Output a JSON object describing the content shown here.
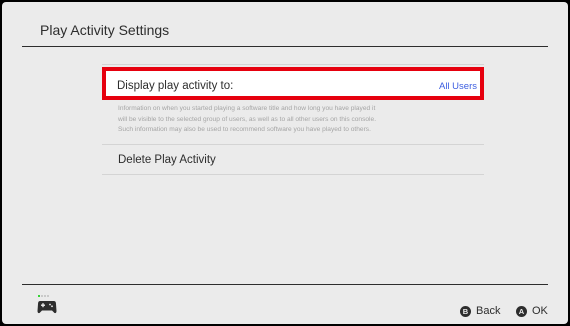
{
  "header": {
    "title": "Play Activity Settings"
  },
  "settings": {
    "display_play_activity": {
      "label": "Display play activity to:",
      "value": "All Users",
      "description": [
        "Information on when you started playing a software title and how long you have played it",
        "will be visible to the selected group of users, as well as to all other users on this console.",
        "Such information may also be used to recommend software you have played to others."
      ]
    },
    "delete_play_activity": {
      "label": "Delete Play Activity"
    }
  },
  "footer": {
    "controller_icon": "controller-icon",
    "back": {
      "glyph": "B",
      "label": "Back"
    },
    "ok": {
      "glyph": "A",
      "label": "OK"
    }
  },
  "colors": {
    "background": "#ebebeb",
    "text": "#2d2d2d",
    "selection_border": "#e6000e",
    "value_blue": "#3d5ee0",
    "description_gray": "#a5a5a5",
    "controller_green": "#35d235"
  }
}
